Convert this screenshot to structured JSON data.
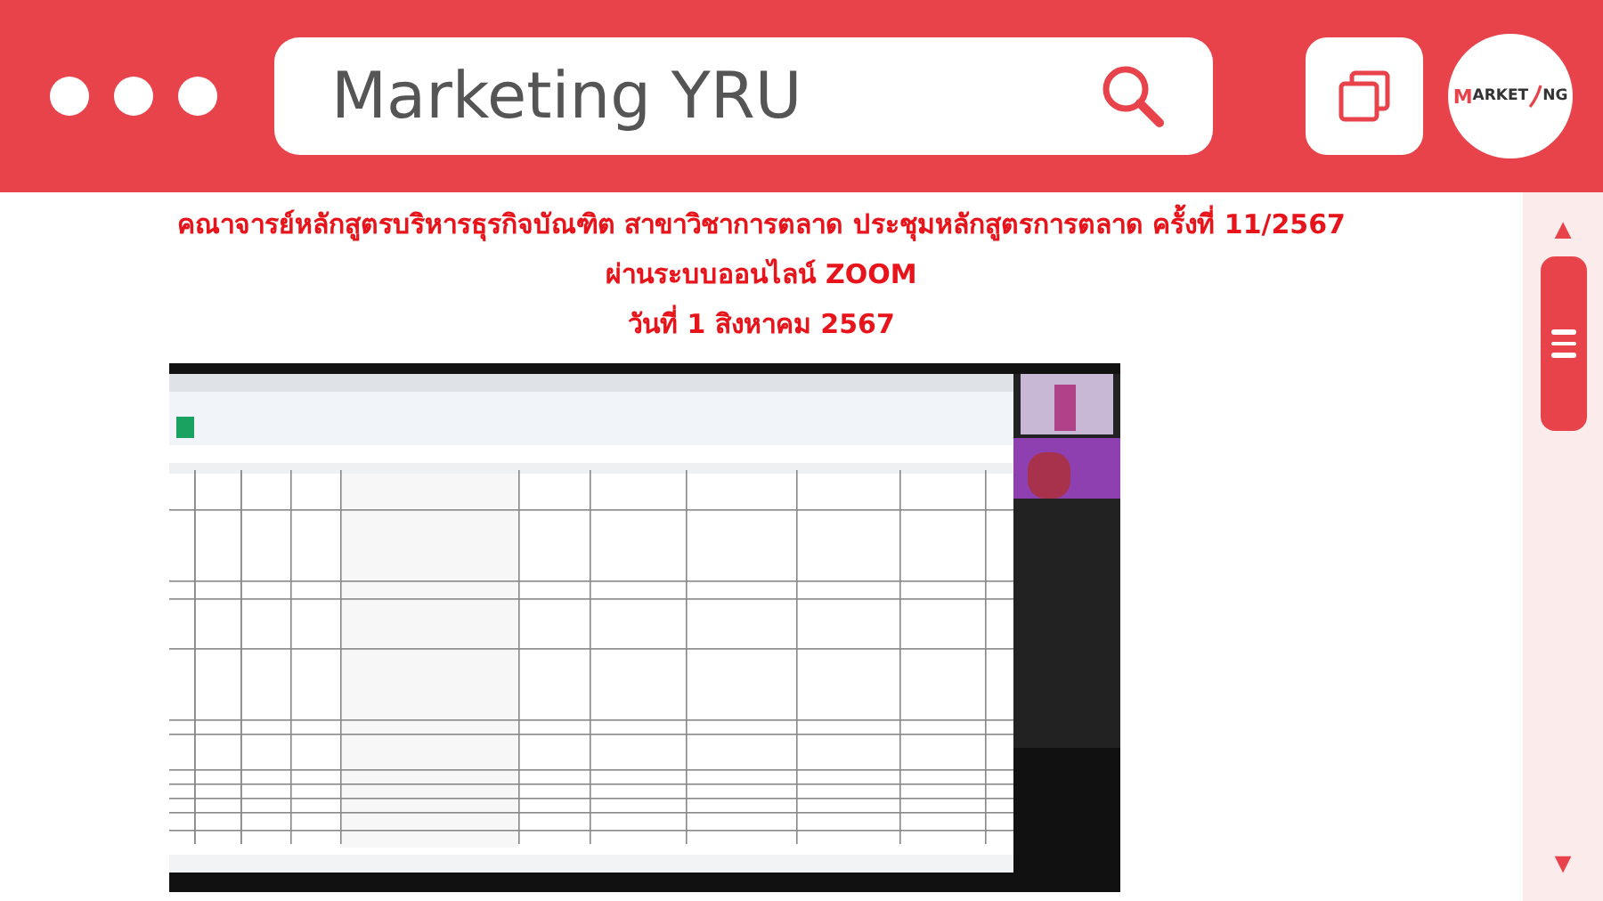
{
  "header": {
    "search": {
      "value": "Marketing YRU"
    },
    "logo": {
      "text_start": "MARKET",
      "text_end": "NG"
    }
  },
  "titles": [
    "คณาจารย์หลักสูตรบริหารธุรกิจบัณฑิต สาขาวิชาการตลาด ประชุมหลักสูตรการตลาด ครั้งที่ 11/2567",
    "ผ่านระบบออนไลน์  ZOOM",
    "วันที่ 1 สิงหาคม 2567"
  ],
  "scrollbar": {
    "up": "▲",
    "down": "▼"
  }
}
